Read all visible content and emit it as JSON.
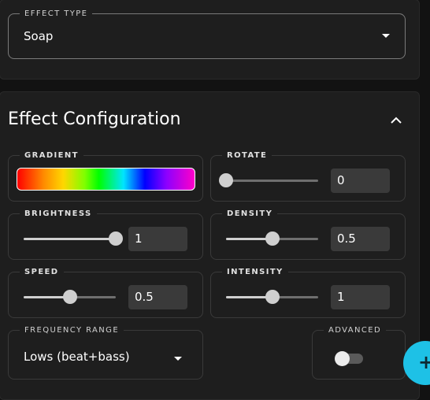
{
  "effect_type": {
    "label": "EFFECT TYPE",
    "value": "Soap"
  },
  "config": {
    "title": "Effect Configuration",
    "gradient": {
      "label": "GRADIENT"
    },
    "rotate": {
      "label": "ROTATE",
      "value": "0",
      "fraction": 0
    },
    "brightness": {
      "label": "BRIGHTNESS",
      "value": "1",
      "fraction": 1
    },
    "density": {
      "label": "DENSITY",
      "value": "0.5",
      "fraction": 0.5
    },
    "speed": {
      "label": "SPEED",
      "value": "0.5",
      "fraction": 0.5
    },
    "intensity": {
      "label": "INTENSITY",
      "value": "1",
      "fraction": 0.5
    },
    "frequency": {
      "label": "FREQUENCY RANGE",
      "value": "Lows (beat+bass)"
    },
    "advanced": {
      "label": "ADVANCED",
      "on": false
    }
  },
  "fab": {
    "icon": "plus-icon",
    "glyph": "+"
  },
  "colors": {
    "accent": "#1ec1e6",
    "card": "#1e1e1e",
    "background": "#121212"
  }
}
